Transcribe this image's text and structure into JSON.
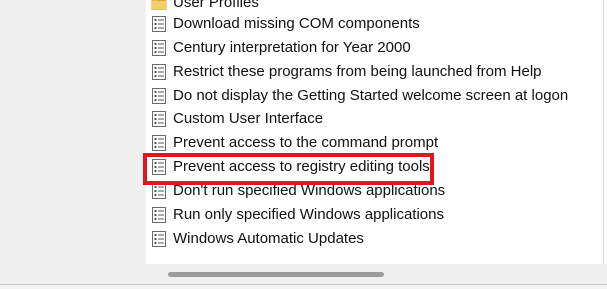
{
  "policy_list": {
    "items": [
      {
        "icon": "folder-icon",
        "label": "User Profiles"
      },
      {
        "icon": "policy-setting-icon",
        "label": "Download missing COM components"
      },
      {
        "icon": "policy-setting-icon",
        "label": "Century interpretation for Year 2000"
      },
      {
        "icon": "policy-setting-icon",
        "label": "Restrict these programs from being launched from Help"
      },
      {
        "icon": "policy-setting-icon",
        "label": "Do not display the Getting Started welcome screen at logon"
      },
      {
        "icon": "policy-setting-icon",
        "label": "Custom User Interface"
      },
      {
        "icon": "policy-setting-icon",
        "label": "Prevent access to the command prompt"
      },
      {
        "icon": "policy-setting-icon",
        "label": "Prevent access to registry editing tools"
      },
      {
        "icon": "policy-setting-icon",
        "label": "Don't run specified Windows applications"
      },
      {
        "icon": "policy-setting-icon",
        "label": "Run only specified Windows applications"
      },
      {
        "icon": "policy-setting-icon",
        "label": "Windows Automatic Updates"
      }
    ],
    "highlighted_item": "Prevent access to registry editing tools"
  },
  "colors": {
    "highlight_border": "#e3171b",
    "folder": "#e8b84a",
    "panel_bg": "#ffffff"
  }
}
